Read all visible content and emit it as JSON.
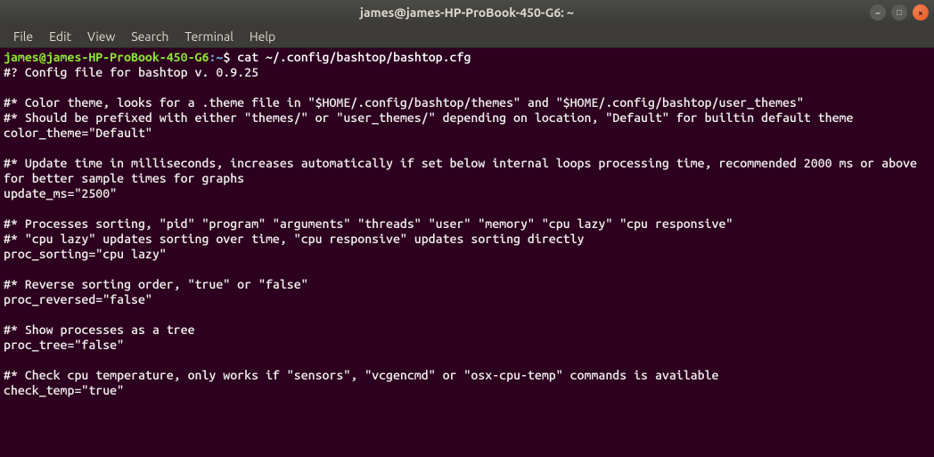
{
  "window": {
    "title": "james@james-HP-ProBook-450-G6: ~"
  },
  "window_controls": {
    "minimize": "–",
    "maximize": "□",
    "close": "×"
  },
  "menubar": {
    "file": "File",
    "edit": "Edit",
    "view": "View",
    "search": "Search",
    "terminal": "Terminal",
    "help": "Help"
  },
  "prompt": {
    "userhost": "james@james-HP-ProBook-450-G6",
    "colon": ":",
    "path": "~",
    "dollar": "$ "
  },
  "command": "cat ~/.config/bashtop/bashtop.cfg",
  "output": {
    "l1": "#? Config file for bashtop v. 0.9.25",
    "l2": "",
    "l3": "#* Color theme, looks for a .theme file in \"$HOME/.config/bashtop/themes\" and \"$HOME/.config/bashtop/user_themes\"",
    "l4": "#* Should be prefixed with either \"themes/\" or \"user_themes/\" depending on location, \"Default\" for builtin default theme",
    "l5": "color_theme=\"Default\"",
    "l6": "",
    "l7": "#* Update time in milliseconds, increases automatically if set below internal loops processing time, recommended 2000 ms or above for better sample times for graphs",
    "l8": "update_ms=\"2500\"",
    "l9": "",
    "l10": "#* Processes sorting, \"pid\" \"program\" \"arguments\" \"threads\" \"user\" \"memory\" \"cpu lazy\" \"cpu responsive\"",
    "l11": "#* \"cpu lazy\" updates sorting over time, \"cpu responsive\" updates sorting directly",
    "l12": "proc_sorting=\"cpu lazy\"",
    "l13": "",
    "l14": "#* Reverse sorting order, \"true\" or \"false\"",
    "l15": "proc_reversed=\"false\"",
    "l16": "",
    "l17": "#* Show processes as a tree",
    "l18": "proc_tree=\"false\"",
    "l19": "",
    "l20": "#* Check cpu temperature, only works if \"sensors\", \"vcgencmd\" or \"osx-cpu-temp\" commands is available",
    "l21": "check_temp=\"true\""
  }
}
